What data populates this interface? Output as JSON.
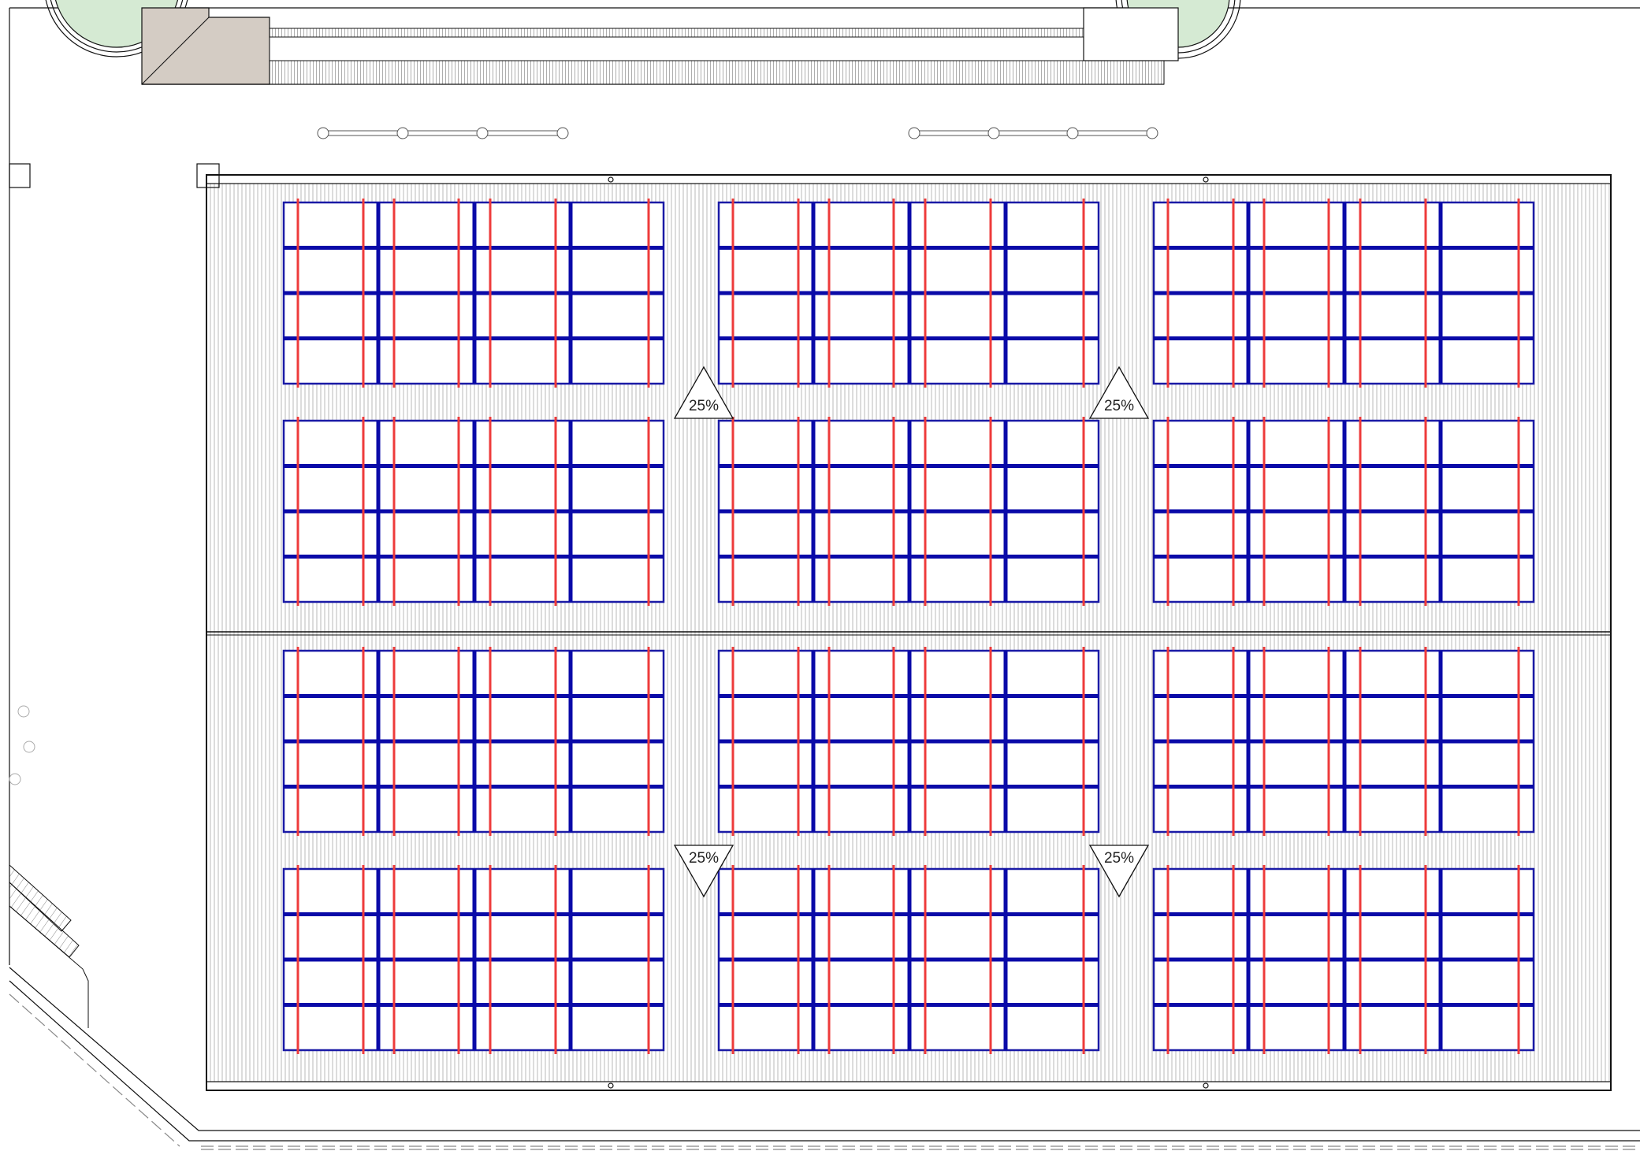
{
  "drawing": {
    "colors": {
      "outline": "#111111",
      "hatch": "#b9b9b9",
      "module_frame": "#1a1aa6",
      "purlin": "#0a0aa8",
      "rail": "#ee3b3b",
      "tree_fill": "#d5ead3",
      "stair_fill": "#d4ccc4",
      "canopy_fill": "#e4ddd6"
    },
    "slope_arrows": [
      {
        "label": "25%",
        "direction": "up"
      },
      {
        "label": "25%",
        "direction": "up"
      },
      {
        "label": "25%",
        "direction": "down"
      },
      {
        "label": "25%",
        "direction": "down"
      }
    ],
    "pv_arrays": {
      "rows": 4,
      "columns": 3,
      "module_rows_per_array": 4,
      "purlins_per_array": 3,
      "rail_pairs_per_array": 3
    }
  }
}
